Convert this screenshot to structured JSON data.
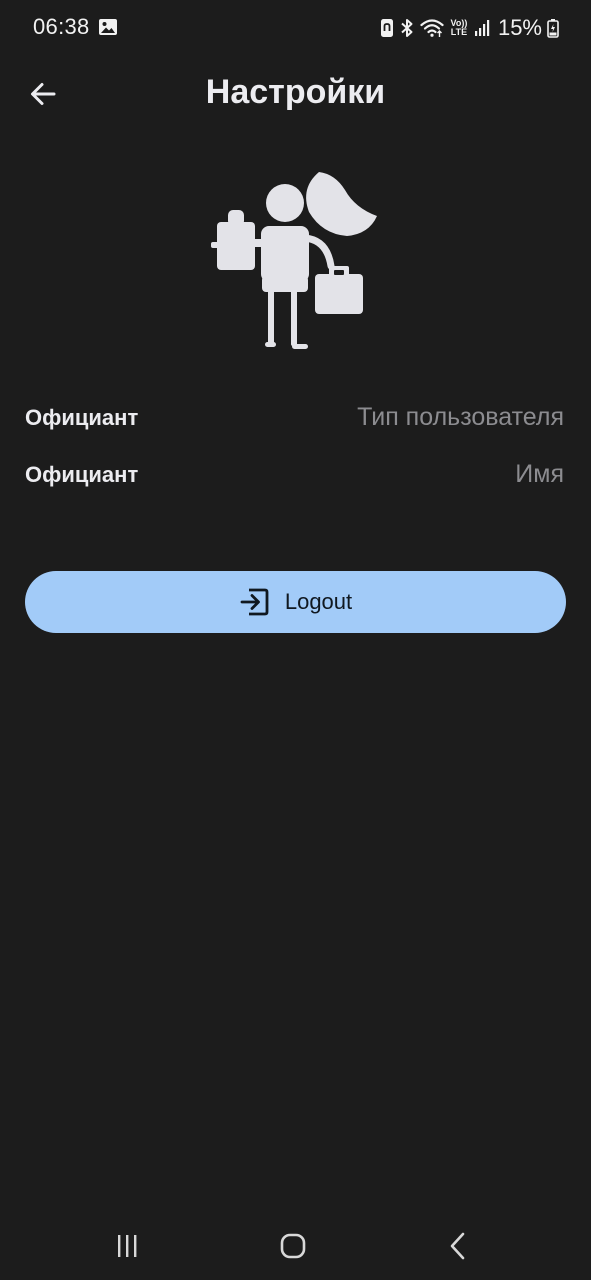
{
  "status_bar": {
    "time": "06:38",
    "battery_percent": "15%",
    "icons": [
      "gallery-icon",
      "nfc-icon",
      "bluetooth-icon",
      "wifi-icon",
      "volte-icon",
      "signal-icon",
      "battery-icon"
    ],
    "volte_top": "Vo))",
    "volte_bottom": "LTE"
  },
  "app_bar": {
    "title": "Настройки",
    "back_icon": "arrow-left-icon"
  },
  "illustration": {
    "icon": "waiter-with-bags-illustration",
    "color": "#e3e3e8"
  },
  "profile": {
    "user_type": {
      "value": "Официант",
      "label": "Тип пользователя"
    },
    "name": {
      "value": "Официант",
      "label": "Имя"
    }
  },
  "logout": {
    "label": "Logout",
    "icon": "logout-icon",
    "background": "#a2cbf8"
  },
  "navigation": {
    "recents_icon": "recents-icon",
    "home_icon": "home-icon",
    "back_icon": "nav-back-icon"
  },
  "colors": {
    "background": "#1c1c1c",
    "text_primary": "#ececf0",
    "text_secondary": "#8c8c90",
    "accent": "#a2cbf8"
  }
}
